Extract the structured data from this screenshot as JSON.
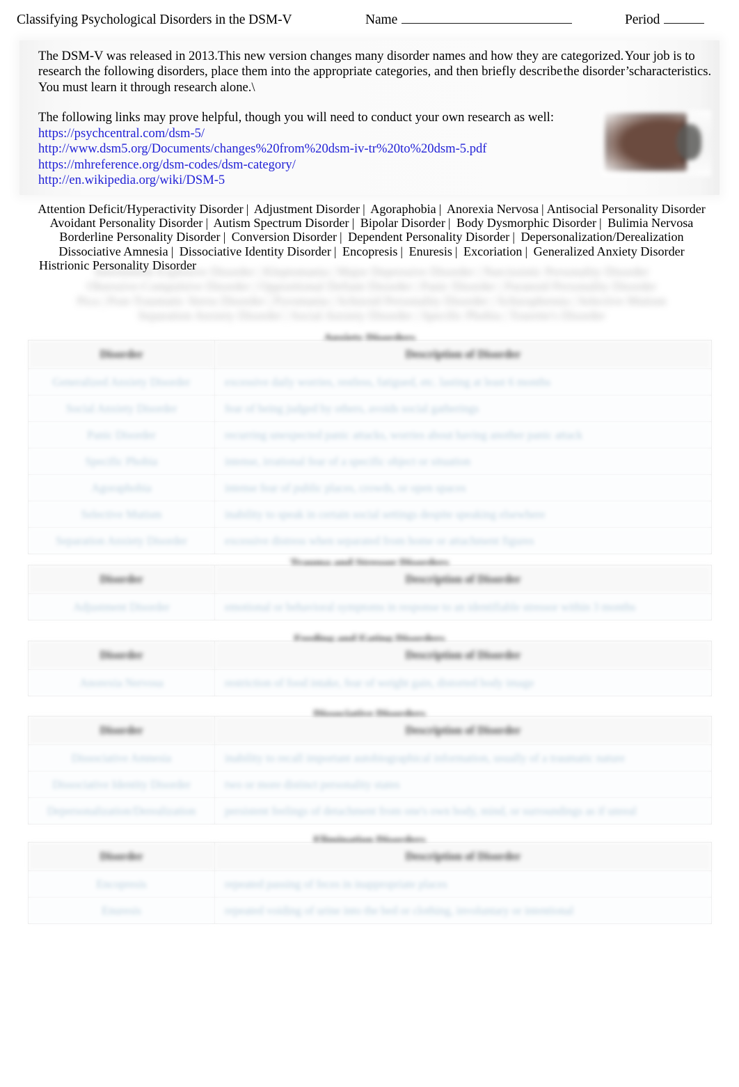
{
  "header": {
    "title": "Classifying Psychological Disorders in the DSM-V",
    "name_label": "Name",
    "period_label": "Period"
  },
  "intro": {
    "paragraph_a": "The DSM-V was released in 2013.",
    "paragraph_b": "This new version changes many disorder names and how they are categorized.",
    "paragraph_c": "Your job is to research the following disorders, place them into the appropriate categories, and then briefly describe",
    "paragraph_d": "the disorder’s",
    "paragraph_e": "characteristics. You must learn it through research alone.\\",
    "links_lead": "The following links may prove helpful, though you will need to conduct your own research as well:",
    "links": [
      "https://psychcentral.com/dsm-5/",
      "http://www.dsm5.org/Documents/changes%20from%20dsm-iv-tr%20to%20dsm-5.pdf",
      "https://mhreference.org/dsm-codes/dsm-category/",
      "http://en.wikipedia.org/wiki/DSM-5"
    ]
  },
  "word_bank": {
    "line1": [
      "Attention Deficit/Hyperactivity Disorder",
      "Adjustment Disorder",
      "Agoraphobia",
      "Anorexia Nervosa",
      "Antisocial Personality Disorder"
    ],
    "line2": [
      "Avoidant Personality Disorder",
      "Autism Spectrum Disorder",
      "Bipolar Disorder",
      "Body Dysmorphic Disorder",
      "Bulimia Nervosa"
    ],
    "line3": [
      "Borderline Personality Disorder",
      "Conversion Disorder",
      "Dependent Personality Disorder",
      "Depersonalization/Derealization"
    ],
    "line4": [
      "Dissociative Amnesia",
      "Dissociative Identity Disorder",
      "Encopresis",
      "Enuresis",
      "Excoriation",
      "Generalized Anxiety Disorder"
    ],
    "line5": [
      "Histrionic Personality Disorder"
    ],
    "separator": "|"
  },
  "tables": {
    "column_headers": {
      "disorder": "Disorder",
      "description": "Description of Disorder"
    },
    "categories": [
      {
        "title": "Anxiety Disorders",
        "rows": [
          {
            "disorder": "Generalized Anxiety Disorder",
            "description": "excessive daily worries, restless, fatigued, etc. lasting at least 6 months"
          },
          {
            "disorder": "Social Anxiety Disorder",
            "description": "fear of being judged by others, avoids social gatherings"
          },
          {
            "disorder": "Panic Disorder",
            "description": "recurring unexpected panic attacks, worries about having another panic attack"
          },
          {
            "disorder": "Specific Phobia",
            "description": "intense, irrational fear of a specific object or situation"
          },
          {
            "disorder": "Agoraphobia",
            "description": "intense fear of public places, crowds, or open spaces"
          },
          {
            "disorder": "Selective Mutism",
            "description": "inability to speak in certain social settings despite speaking elsewhere"
          },
          {
            "disorder": "Separation Anxiety Disorder",
            "description": "excessive distress when separated from home or attachment figures"
          }
        ]
      },
      {
        "title": "Trauma and Stressor Disorders",
        "rows": [
          {
            "disorder": "Adjustment Disorder",
            "description": "emotional or behavioral symptoms in response to an identifiable stressor within 3 months"
          }
        ]
      },
      {
        "title": "Feeding and Eating Disorders",
        "rows": [
          {
            "disorder": "Anorexia Nervosa",
            "description": "restriction of food intake, fear of weight gain, distorted body image"
          }
        ]
      },
      {
        "title": "Dissociative Disorders",
        "rows": [
          {
            "disorder": "Dissociative Amnesia",
            "description": "inability to recall important autobiographical information, usually of a traumatic nature"
          },
          {
            "disorder": "Dissociative Identity Disorder",
            "description": "two or more distinct personality states"
          },
          {
            "disorder": "Depersonalization/Derealization",
            "description": "persistent feelings of detachment from one's own body, mind, or surroundings as if unreal"
          }
        ]
      },
      {
        "title": "Elimination Disorders",
        "rows": [
          {
            "disorder": "Encopresis",
            "description": "repeated passing of feces in inappropriate places"
          },
          {
            "disorder": "Enuresis",
            "description": "repeated voiding of urine into the bed or clothing, involuntary or intentional"
          }
        ]
      }
    ]
  }
}
